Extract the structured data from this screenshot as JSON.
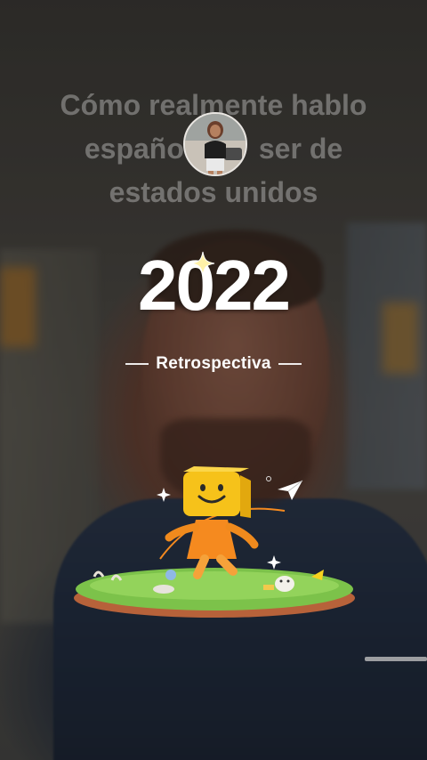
{
  "caption": {
    "line1": "Cómo realmente hablo",
    "line2_left": "españo",
    "line2_right": "ser de",
    "line3": "estados unidos"
  },
  "year_card": {
    "year": "2022",
    "subtitle": "Retrospectiva"
  },
  "icons": {
    "sparkle": "sparkle-icon",
    "paper_plane": "paper-plane-icon",
    "mascot": "smiley-block-mascot"
  },
  "colors": {
    "year_text": "#ffffff",
    "mascot_head": "#f6c21a",
    "mascot_body": "#f58a1f",
    "grass": "#7cc24a",
    "soil": "#b7623a"
  }
}
